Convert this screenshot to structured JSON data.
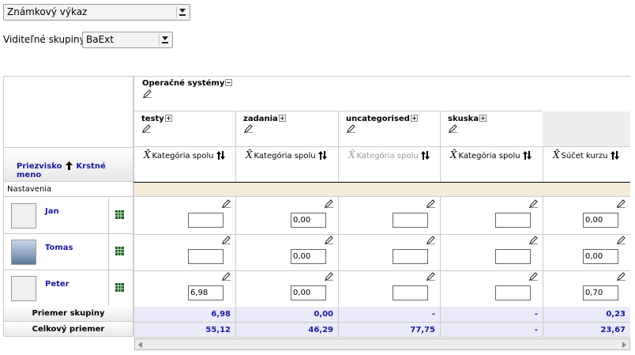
{
  "report_select": {
    "value": "Známkový výkaz"
  },
  "groups": {
    "label": "Viditeľné skupiny",
    "value": "BaExt"
  },
  "header": {
    "sort_surname": "Priezvisko",
    "sort_firstname": "Krstné meno",
    "top_category": "Operačné systémy",
    "categories": [
      {
        "name": "testy",
        "total_label": "Kategória spolu",
        "greyed": false
      },
      {
        "name": "zadania",
        "total_label": "Kategória spolu",
        "greyed": false
      },
      {
        "name": "uncategorised",
        "total_label": "Kategória spolu",
        "greyed": true
      },
      {
        "name": "skuska",
        "total_label": "Kategória spolu",
        "greyed": false
      }
    ],
    "course_total_label": "Súčet kurzu"
  },
  "settings_row": {
    "label": "Nastavenia"
  },
  "students": [
    {
      "first": "Jan",
      "grades": [
        "",
        "0,00",
        "",
        "",
        "0,00"
      ]
    },
    {
      "first": "Tomas",
      "grades": [
        "",
        "0,00",
        "",
        "",
        "0,00"
      ]
    },
    {
      "first": "Peter",
      "grades": [
        "6,98",
        "0,00",
        "",
        "",
        "0,70"
      ]
    }
  ],
  "group_avg": {
    "label": "Priemer skupiny",
    "values": [
      "6,98",
      "0,00",
      "-",
      "-",
      "0,23"
    ]
  },
  "overall_avg": {
    "label": "Celkový priemer",
    "values": [
      "55,12",
      "46,29",
      "77,75",
      "-",
      "23,67"
    ]
  },
  "colors": {
    "link": "#1a1a9c",
    "avg_bg": "#eaeaf8",
    "settings_bg": "#f5ecd8"
  }
}
